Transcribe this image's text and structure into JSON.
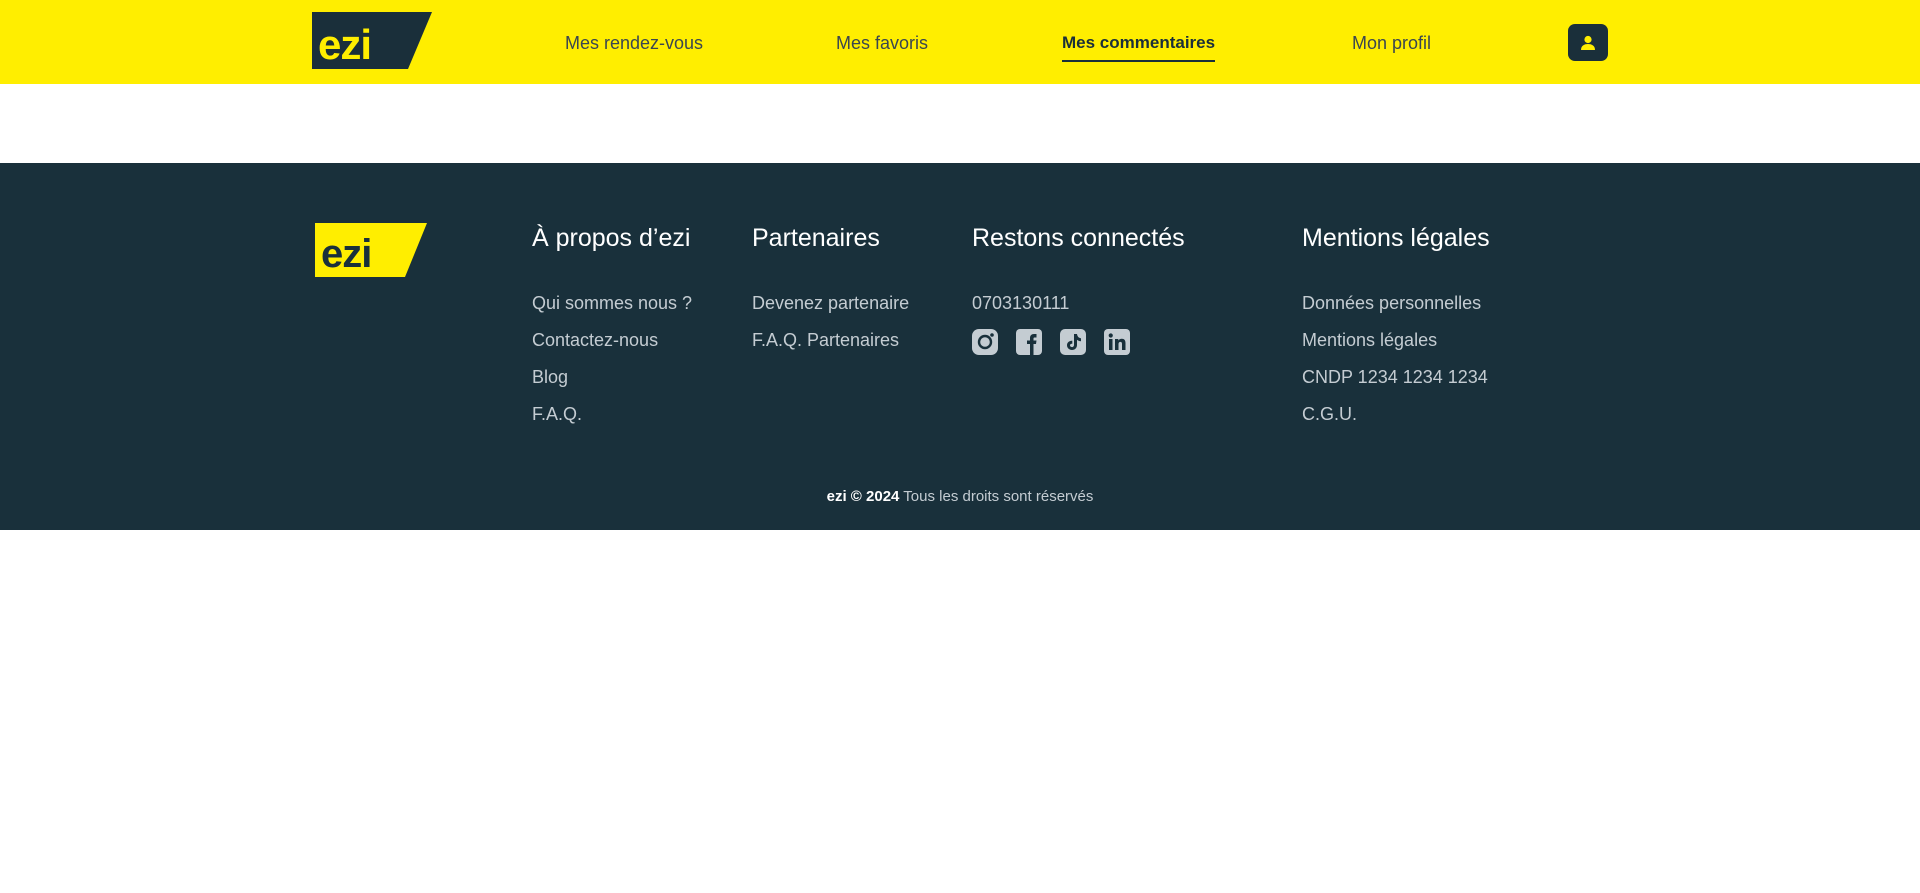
{
  "brand": {
    "logo_text": "ezi",
    "primary_color": "#ffee00",
    "dark_color": "#19303b"
  },
  "nav": {
    "items": [
      {
        "label": "Mes rendez-vous",
        "active": false
      },
      {
        "label": "Mes favoris",
        "active": false
      },
      {
        "label": "Mes commentaires",
        "active": true
      },
      {
        "label": "Mon profil",
        "active": false
      }
    ],
    "profile_icon": "user-icon"
  },
  "footer": {
    "columns": [
      {
        "title": "À propos d’ezi",
        "links": [
          "Qui sommes nous ?",
          "Contactez-nous",
          "Blog",
          "F.A.Q."
        ]
      },
      {
        "title": "Partenaires",
        "links": [
          "Devenez partenaire",
          "F.A.Q. Partenaires"
        ]
      },
      {
        "title": "Restons connectés",
        "phone": "0703130111",
        "social_icons": [
          "instagram-icon",
          "facebook-icon",
          "tiktok-icon",
          "linkedin-icon"
        ]
      },
      {
        "title": "Mentions légales",
        "links": [
          "Données personnelles",
          "Mentions légales",
          "CNDP 1234 1234 1234",
          "C.G.U."
        ]
      }
    ],
    "copyright": {
      "brand": "ezi © 2024",
      "text": "Tous les droits sont réservés"
    }
  }
}
